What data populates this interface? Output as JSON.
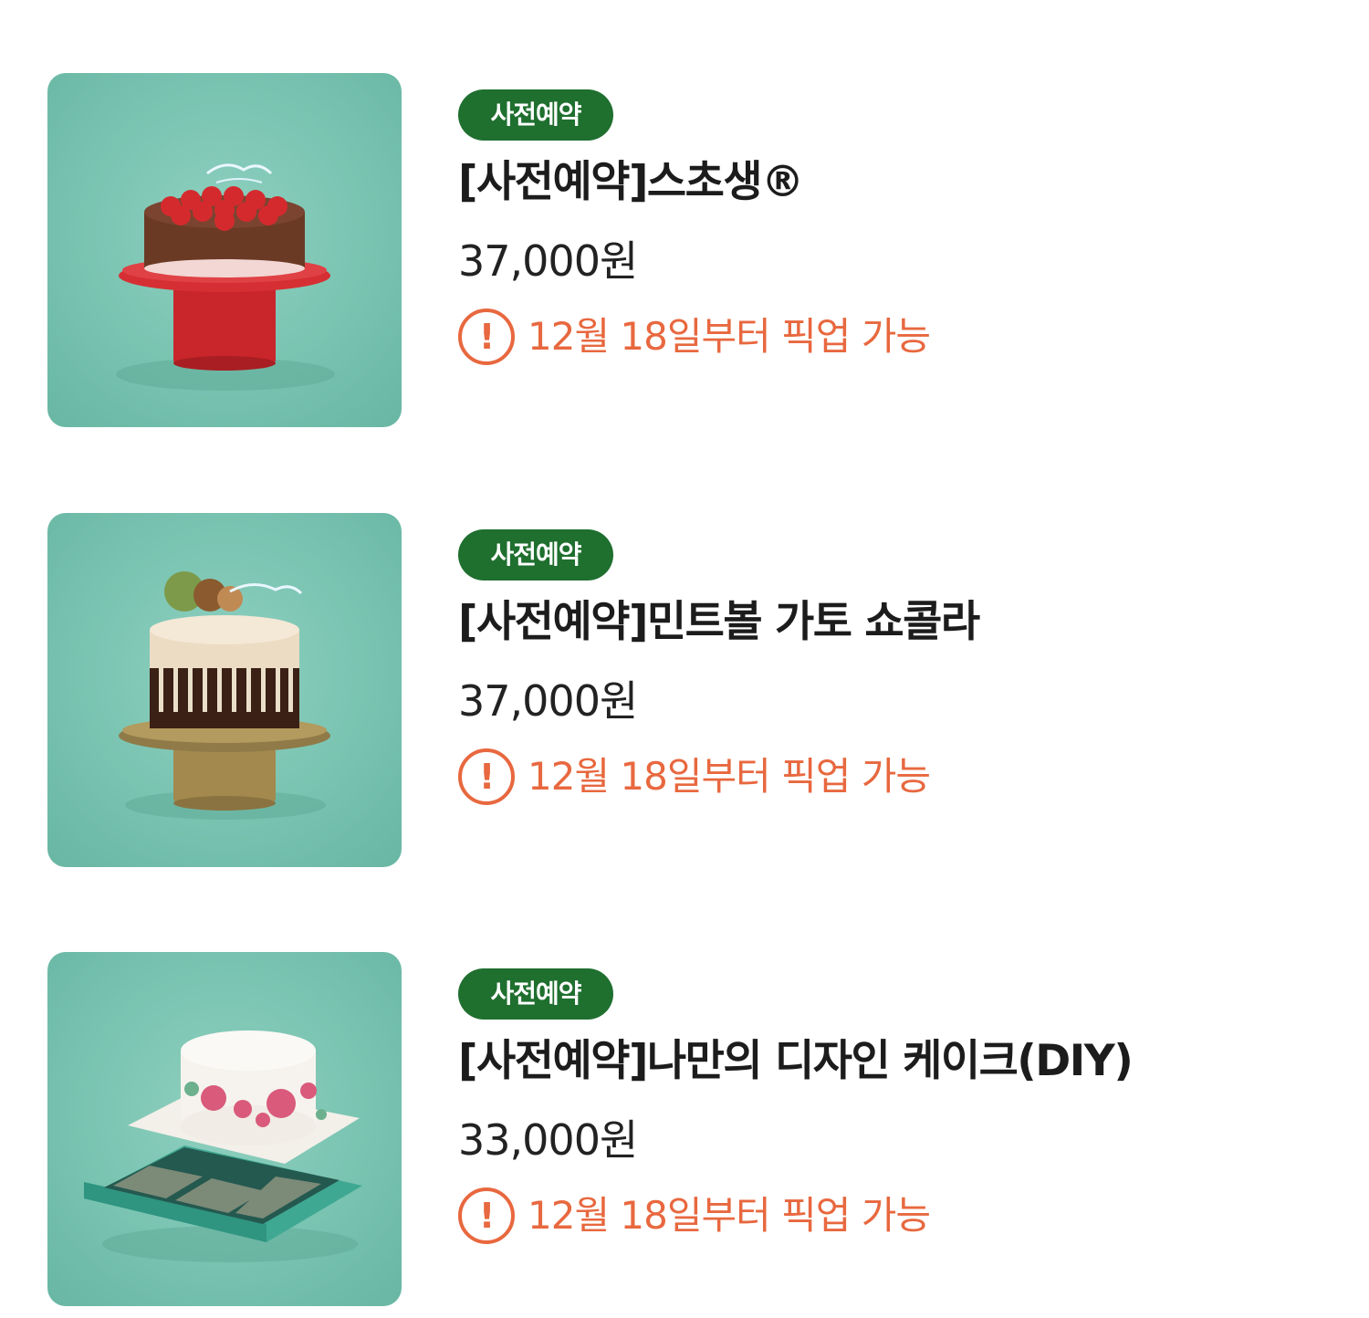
{
  "products": [
    {
      "badge": "사전예약",
      "title": "[사전예약]스초생®",
      "price": "37,000원",
      "notice_icon": "!",
      "notice": "12월 18일부터 픽업 가능",
      "image_icon": "strawberry-chocolate-cake"
    },
    {
      "badge": "사전예약",
      "title": "[사전예약]민트볼 가토 쇼콜라",
      "price": "37,000원",
      "notice_icon": "!",
      "notice": "12월 18일부터 픽업 가능",
      "image_icon": "mint-ball-gateau-cake"
    },
    {
      "badge": "사전예약",
      "title": "[사전예약]나만의 디자인 케이크(DIY)",
      "price": "33,000원",
      "notice_icon": "!",
      "notice": "12월 18일부터 픽업 가능",
      "image_icon": "diy-design-cake-kit"
    }
  ],
  "colors": {
    "badge_bg": "#1f6f2f",
    "notice": "#e8683f",
    "thumb_bg": "#79c3b1"
  }
}
